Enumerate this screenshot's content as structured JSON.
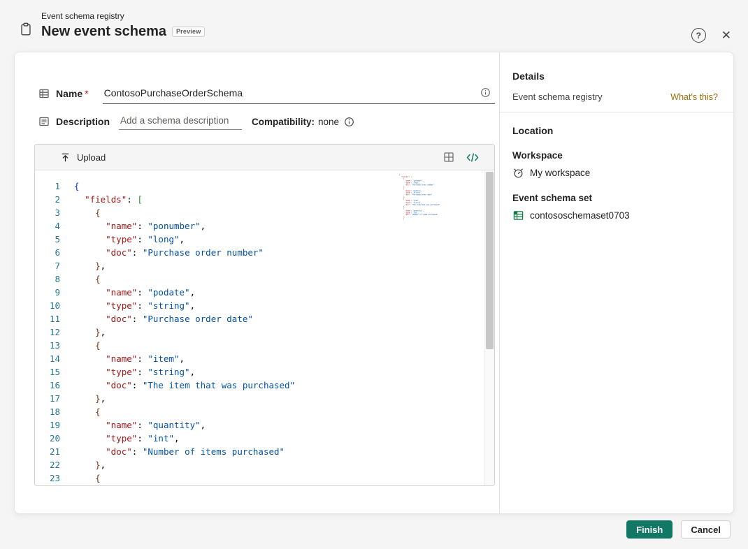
{
  "header": {
    "breadcrumb": "Event schema registry",
    "title": "New event schema",
    "preview_badge": "Preview"
  },
  "form": {
    "name": {
      "label": "Name",
      "required_mark": "*",
      "value": "ContosoPurchaseOrderSchema"
    },
    "description": {
      "label": "Description",
      "placeholder": "Add a schema description"
    },
    "compatibility": {
      "label": "Compatibility:",
      "value": "none"
    }
  },
  "editor": {
    "upload_label": "Upload",
    "line_numbers_start": 1,
    "code_lines": [
      "{",
      "  \"fields\": [",
      "    {",
      "      \"name\": \"ponumber\",",
      "      \"type\": \"long\",",
      "      \"doc\": \"Purchase order number\"",
      "    },",
      "    {",
      "      \"name\": \"podate\",",
      "      \"type\": \"string\",",
      "      \"doc\": \"Purchase order date\"",
      "    },",
      "    {",
      "      \"name\": \"item\",",
      "      \"type\": \"string\",",
      "      \"doc\": \"The item that was purchased\"",
      "    },",
      "    {",
      "      \"name\": \"quantity\",",
      "      \"type\": \"int\",",
      "      \"doc\": \"Number of items purchased\"",
      "    },",
      "    {"
    ]
  },
  "details": {
    "title": "Details",
    "type_label": "Event schema registry",
    "whats_this_link": "What's this?",
    "location_title": "Location",
    "workspace_label": "Workspace",
    "workspace_value": "My workspace",
    "schema_set_label": "Event schema set",
    "schema_set_value": "contososchemaset0703"
  },
  "footer": {
    "finish_label": "Finish",
    "cancel_label": "Cancel"
  },
  "colors": {
    "accent": "#117865",
    "link": "#986f0b",
    "json_key": "#a31515",
    "json_string": "#0451a5",
    "line_number": "#237893",
    "bracket_colors": [
      "#0431fa",
      "#319331",
      "#7b3814"
    ]
  }
}
